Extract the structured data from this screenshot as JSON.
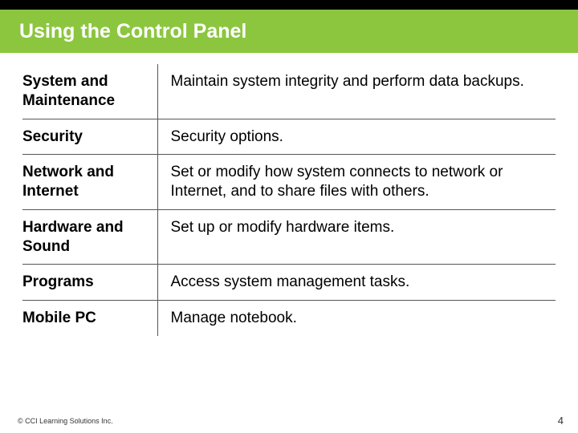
{
  "title": "Using the Control Panel",
  "rows": [
    {
      "term": "System and Maintenance",
      "desc": "Maintain system integrity and perform data backups."
    },
    {
      "term": "Security",
      "desc": "Security options."
    },
    {
      "term": "Network and Internet",
      "desc": "Set or modify how system connects to network or Internet, and to share files with others."
    },
    {
      "term": "Hardware and Sound",
      "desc": "Set up or modify hardware items."
    },
    {
      "term": "Programs",
      "desc": "Access system management tasks."
    },
    {
      "term": "Mobile PC",
      "desc": "Manage notebook."
    }
  ],
  "footer": {
    "copyright": "© CCI Learning Solutions Inc.",
    "page": "4"
  }
}
